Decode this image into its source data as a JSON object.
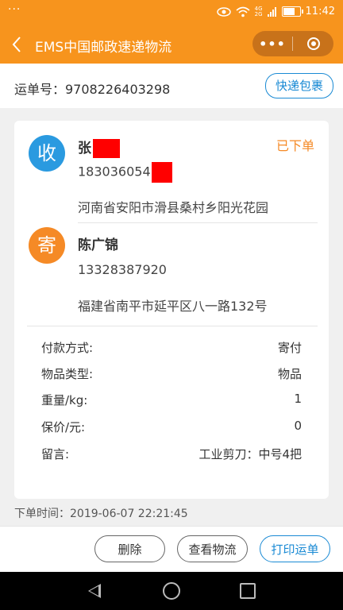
{
  "status_bar": {
    "left_dots": "···",
    "net_top": "4G",
    "net_bottom": "2G",
    "time": "11:42",
    "battery_level": 0.8
  },
  "nav": {
    "back_icon": "chevron-left-icon",
    "title": "EMS中国邮政速递物流",
    "more_icon": "more-dots-icon",
    "more_label": "•••",
    "close_icon": "target-icon"
  },
  "tracking": {
    "label": "运单号：9708226403298",
    "type_button": "快递包裹"
  },
  "receiver": {
    "icon_char": "收",
    "name": "张",
    "phone": "183036054",
    "address": "河南省安阳市滑县桑村乡阳光花园",
    "status": "已下单"
  },
  "sender": {
    "icon_char": "寄",
    "name": "陈广锦",
    "phone": "13328387920",
    "address": "福建省南平市延平区八一路132号"
  },
  "details": [
    {
      "label": "付款方式:",
      "value": "寄付"
    },
    {
      "label": "物品类型:",
      "value": "物品"
    },
    {
      "label": "重量/kg:",
      "value": "1"
    },
    {
      "label": "保价/元:",
      "value": "0"
    },
    {
      "label": "留言:",
      "value": "工业剪刀：中号4把"
    }
  ],
  "order_time": "下单时间：2019-06-07 22:21:45",
  "actions": {
    "delete": "删除",
    "view_tracking": "查看物流",
    "print": "打印运单"
  },
  "colors": {
    "brand_orange": "#f7941d",
    "accent_blue": "#1a8ad4",
    "status_orange": "#f58a26"
  }
}
